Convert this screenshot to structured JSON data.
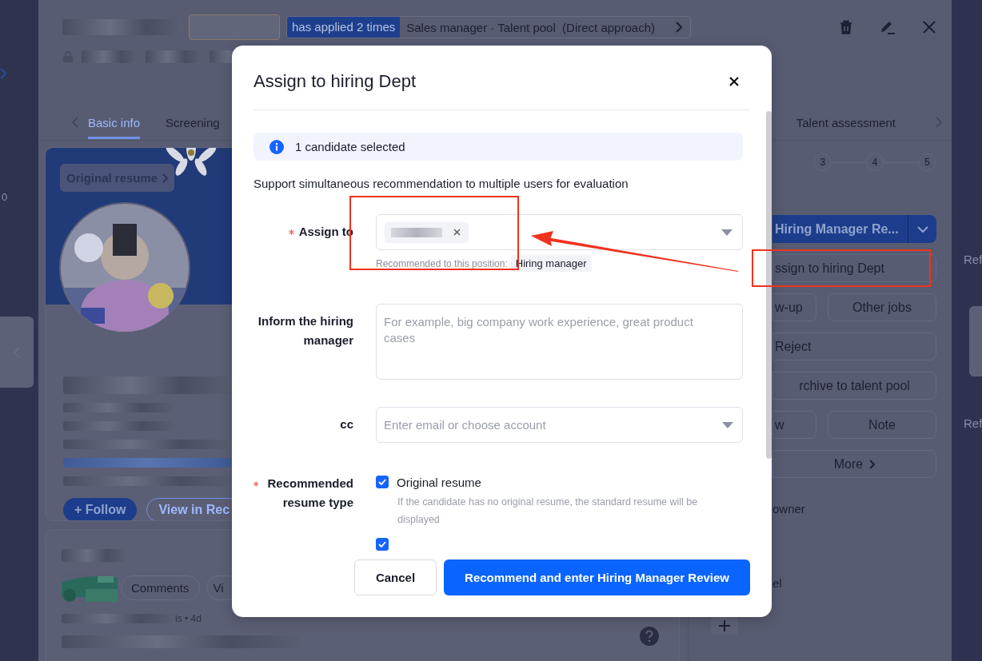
{
  "left_nav": {
    "fragment": "0"
  },
  "header": {
    "applied_tag": "has applied 2 times",
    "position": "Sales manager · Talent pool  (Direct approach)"
  },
  "tabs": [
    {
      "label": "Basic info",
      "selected": true
    },
    {
      "label": "Screening",
      "selected": false
    },
    {
      "label": "Talent assessment",
      "selected": false
    }
  ],
  "profile": {
    "resume_link": "Original resume",
    "follow_button": "+ Follow",
    "view_button": "View in Rec"
  },
  "activity": {
    "comments_button": "Comments",
    "view_button": "Vi",
    "meta": "is • 4d"
  },
  "stepper": [
    "3",
    "4",
    "5"
  ],
  "actions": [
    {
      "label": "Hiring Manager Re...",
      "kind": "primary"
    },
    {
      "label": "ssign to hiring Dept",
      "kind": "wide"
    },
    {
      "label": "w-up",
      "kind": "half"
    },
    {
      "label": "Other jobs",
      "kind": "half"
    },
    {
      "label": "Reject",
      "kind": "wide"
    },
    {
      "label": "rchive to talent pool",
      "kind": "wide"
    },
    {
      "label": "w",
      "kind": "half"
    },
    {
      "label": "Note",
      "kind": "half"
    },
    {
      "label": "More",
      "kind": "more"
    }
  ],
  "info_labels": [
    "owner",
    "el"
  ],
  "side_labels": [
    "Ref",
    "Ref"
  ],
  "dialog": {
    "title": "Assign to hiring Dept",
    "notice": "1 candidate selected",
    "description": "Support simultaneous recommendation to multiple users for evaluation",
    "assign_to": {
      "label": "Assign to",
      "required": true,
      "hint": "Recommended to this position:",
      "hint_tag": "Hiring manager"
    },
    "inform": {
      "label": "Inform the hiring manager",
      "required": false,
      "placeholder": "For example, big company work experience, great product cases"
    },
    "cc": {
      "label": "cc",
      "required": false,
      "placeholder": "Enter email or choose account"
    },
    "resume_type": {
      "label": "Recommended resume type",
      "required": true,
      "options": [
        {
          "label": "Original resume",
          "checked": true,
          "hint": "If the candidate has no original resume, the standard resume will be displayed"
        },
        {
          "checked": true
        }
      ]
    },
    "buttons": [
      {
        "label": "Cancel",
        "kind": "secondary"
      },
      {
        "label": "Recommend and enter Hiring Manager Review",
        "kind": "primary"
      }
    ]
  }
}
